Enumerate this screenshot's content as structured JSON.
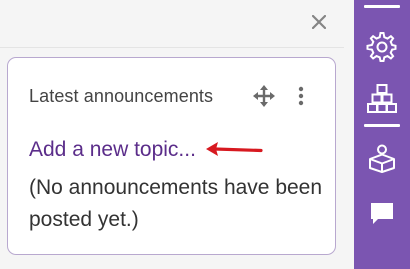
{
  "colors": {
    "accent": "#7b55b1",
    "link": "#5b2d8a",
    "annotation_arrow": "#d71920",
    "card_border": "#b8a8cf"
  },
  "header": {
    "close_icon": "close-icon"
  },
  "block": {
    "title": "Latest announcements",
    "move_icon": "move-icon",
    "menu_icon": "kebab-menu-icon",
    "add_topic_link": "Add a new topic...",
    "empty_message": "(No announcements have been posted yet.)"
  },
  "drawer": {
    "items": [
      {
        "icon": "gear-icon"
      },
      {
        "icon": "blocks-icon",
        "active": true
      },
      {
        "icon": "course-index-icon"
      },
      {
        "icon": "chat-icon"
      }
    ]
  }
}
